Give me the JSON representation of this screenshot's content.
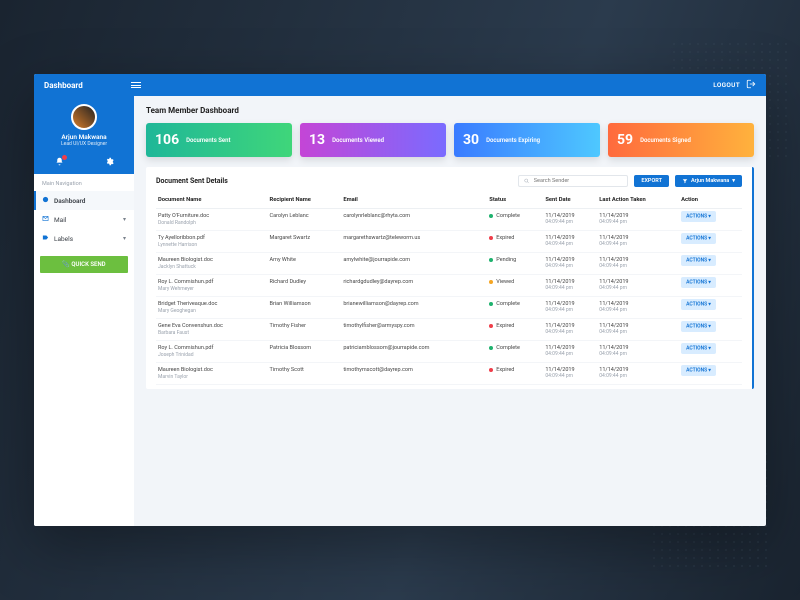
{
  "header": {
    "title": "Dashboard",
    "logout": "LOGOUT"
  },
  "profile": {
    "name": "Arjun Makwana",
    "role": "Lead UI/UX Designer"
  },
  "sidebar": {
    "section": "Main Navigation",
    "items": [
      {
        "label": "Dashboard",
        "icon": "dashboard",
        "active": true
      },
      {
        "label": "Mail",
        "icon": "mail",
        "chev": true
      },
      {
        "label": "Labels",
        "icon": "label",
        "chev": true
      }
    ],
    "quicksend": "QUICK SEND"
  },
  "main": {
    "title": "Team Member Dashboard",
    "cards": [
      {
        "num": "106",
        "label": "Documents Sent"
      },
      {
        "num": "13",
        "label": "Documents Viewed"
      },
      {
        "num": "30",
        "label": "Documents Expiring"
      },
      {
        "num": "59",
        "label": "Documents Signed"
      }
    ],
    "panel": {
      "title": "Document Sent Details",
      "search_placeholder": "Search Sender",
      "export": "EXPORT",
      "filter_user": "Arjun Makwana",
      "columns": [
        "Document Name",
        "Recipient Name",
        "Email",
        "Status",
        "Sent Date",
        "Last Action Taken",
        "Action"
      ],
      "action_label": "ACTIONS",
      "rows": [
        {
          "doc": "Patty O'Furniture.doc",
          "sender": "Donald Randolph",
          "recipient": "Carolyn Leblanc",
          "email": "carolynrleblanc@rhyta.com",
          "status": "Complete",
          "dot": "green",
          "sent_d": "11/14/2019",
          "sent_t": "04:09:44 pm",
          "act_d": "11/14/2019",
          "act_t": "04:09:44 pm"
        },
        {
          "doc": "Ty Ayelloribbon.pdf",
          "sender": "Lynnette Harrison",
          "recipient": "Margaret Swartz",
          "email": "margarethswartz@teleworm.us",
          "status": "Expired",
          "dot": "red",
          "sent_d": "11/14/2019",
          "sent_t": "04:09:44 pm",
          "act_d": "11/14/2019",
          "act_t": "04:09:44 pm"
        },
        {
          "doc": "Maureen Biologist.doc",
          "sender": "Jacklyn Shattuck",
          "recipient": "Amy White",
          "email": "amylwhite@jourrapide.com",
          "status": "Pending",
          "dot": "green",
          "sent_d": "11/14/2019",
          "sent_t": "04:09:44 pm",
          "act_d": "11/14/2019",
          "act_t": "04:09:44 pm"
        },
        {
          "doc": "Roy L. Commishun.pdf",
          "sender": "Mary Wehmeyer",
          "recipient": "Richard Dudley",
          "email": "richardgdudley@dayrep.com",
          "status": "Viewed",
          "dot": "orange",
          "sent_d": "11/14/2019",
          "sent_t": "04:09:44 pm",
          "act_d": "11/14/2019",
          "act_t": "04:09:44 pm"
        },
        {
          "doc": "Bridget Theriveaque.doc",
          "sender": "Mary Geoghegan",
          "recipient": "Brian Williamson",
          "email": "brianewilliamson@dayrep.com",
          "status": "Complete",
          "dot": "green",
          "sent_d": "11/14/2019",
          "sent_t": "04:09:44 pm",
          "act_d": "11/14/2019",
          "act_t": "04:09:44 pm"
        },
        {
          "doc": "Gene Eva Convenshun.doc",
          "sender": "Barbara Faust",
          "recipient": "Timothy Fisher",
          "email": "timothylfisher@armyspy.com",
          "status": "Expired",
          "dot": "red",
          "sent_d": "11/14/2019",
          "sent_t": "04:09:44 pm",
          "act_d": "11/14/2019",
          "act_t": "04:09:44 pm"
        },
        {
          "doc": "Roy L. Commishun.pdf",
          "sender": "Joseph Trinidad",
          "recipient": "Patricia Blossom",
          "email": "patriciamblossom@jourrapide.com",
          "status": "Complete",
          "dot": "green",
          "sent_d": "11/14/2019",
          "sent_t": "04:09:44 pm",
          "act_d": "11/14/2019",
          "act_t": "04:09:44 pm"
        },
        {
          "doc": "Maureen Biologist.doc",
          "sender": "Marvin Taylor",
          "recipient": "Timothy Scott",
          "email": "timothymscott@dayrep.com",
          "status": "Expired",
          "dot": "red",
          "sent_d": "11/14/2019",
          "sent_t": "04:09:44 pm",
          "act_d": "11/14/2019",
          "act_t": "04:09:44 pm"
        }
      ]
    }
  }
}
